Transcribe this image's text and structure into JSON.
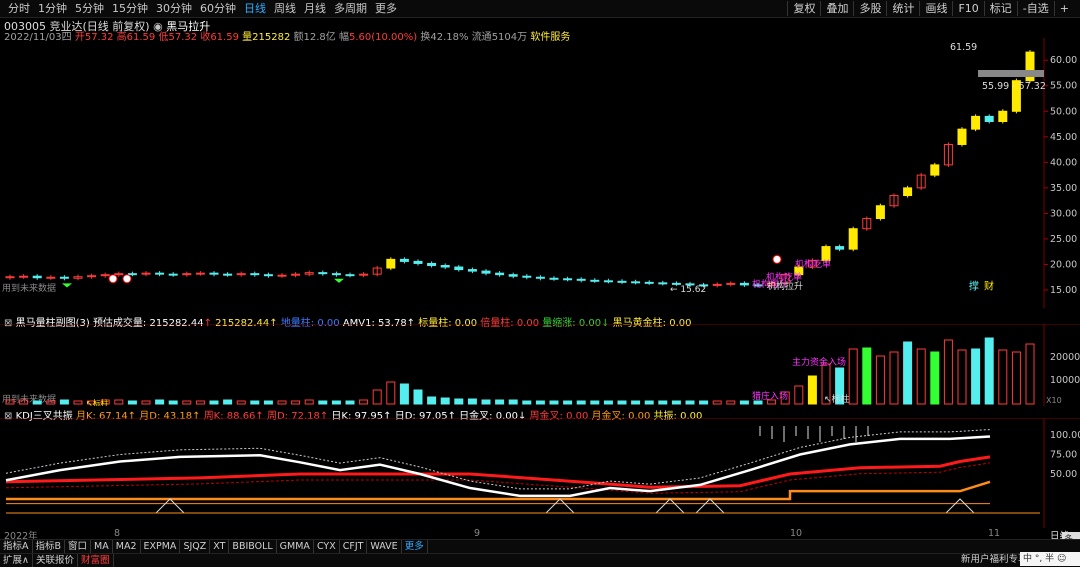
{
  "top_tabs": [
    "分时",
    "1分钟",
    "5分钟",
    "15分钟",
    "30分钟",
    "60分钟",
    "日线",
    "周线",
    "月线",
    "多周期",
    "更多"
  ],
  "active_tab": "日线",
  "right_tools": [
    "复权",
    "叠加",
    "多股",
    "统计",
    "画线",
    "F10",
    "标记",
    "-自选",
    "+"
  ],
  "title": {
    "code": "003005",
    "name": "竞业达(日线 前复权)",
    "indicator": "黑马拉升"
  },
  "quote": {
    "date": "2022/11/03四",
    "open_label": "开",
    "open": "57.32",
    "high_label": "高",
    "high": "61.59",
    "low_label": "低",
    "low": "57.32",
    "close_label": "收",
    "close": "61.59",
    "vol_label": "量",
    "vol": "215282",
    "amount_label": "额",
    "amount": "12.8亿",
    "chg_label": "幅",
    "chg": "5.60(10.00%)",
    "turnover_label": "换",
    "turnover": "42.18%",
    "float_label": "流通",
    "float": "5104万",
    "service": "软件服务"
  },
  "price_axis": [
    "60.00",
    "55.00",
    "50.00",
    "45.00",
    "40.00",
    "35.00",
    "30.00",
    "25.00",
    "20.00",
    "15.00"
  ],
  "annotations": {
    "max_label": "61.59",
    "range_label": "55.99 - 57.32",
    "low_label": "15.62",
    "future_text": "用到未来数据",
    "future_text2": "用到未来数据",
    "sig1": "机构吃单",
    "sig2": "机构吃单",
    "sig3": "机构拉升",
    "sig4": "机构拉升",
    "badge1": "撑",
    "badge2": "财",
    "sig5": "黑马",
    "sig6": "猎庄入场",
    "sig7": "猎庄",
    "sig8": "主力资金入场",
    "sig9": "标柱"
  },
  "panel2": {
    "name": "黑马量柱副图(3)",
    "est_label": "预估成交量:",
    "est_val": "215282.44",
    "est_arrow": "↑",
    "val2": "215282.44↑",
    "vol_ma_label": "地量柱: 0.00",
    "amv_label": "AMV1: 53.78↑",
    "biao_label": "标量柱: 0.00",
    "bei_label": "倍量柱: 0.00",
    "suo_label": "量缩涨: 0.00↓",
    "hj_label": "黑马黄金柱: 0.00",
    "axis": [
      "20000",
      "10000"
    ],
    "x10": "X10"
  },
  "panel3": {
    "name": "KDJ三叉共振",
    "items": [
      {
        "t": "月K: 67.14↑",
        "c": "orange"
      },
      {
        "t": "月D: 43.18↑",
        "c": "orange"
      },
      {
        "t": "周K: 88.66↑",
        "c": "red"
      },
      {
        "t": "周D: 72.18↑",
        "c": "red"
      },
      {
        "t": "日K: 97.95↑",
        "c": "white"
      },
      {
        "t": "日D: 97.05↑",
        "c": "white"
      },
      {
        "t": "日金叉: 0.00↓",
        "c": "white"
      },
      {
        "t": "周金叉: 0.00",
        "c": "red"
      },
      {
        "t": "月金叉: 0.00",
        "c": "orange"
      },
      {
        "t": "共振: 0.00",
        "c": "yellow"
      }
    ],
    "axis": [
      "100.00",
      "75.00",
      "50.00"
    ]
  },
  "date_axis": [
    "2022年",
    "8",
    "9",
    "10",
    "11"
  ],
  "corner_label": "日线",
  "bottom_tabs": [
    "指标A",
    "指标B",
    "窗口",
    "MA",
    "MA2",
    "EXPMA",
    "SJQZ",
    "XT",
    "BBIBOLL",
    "GMMA",
    "CYX",
    "CFJT",
    "WAVE",
    "更多"
  ],
  "status_tabs": [
    "扩展∧",
    "关联报价",
    "财富圈"
  ],
  "promo": "新用户福利专享 图",
  "side_buttons": [
    "多股"
  ],
  "ime": "中 °, 半 ☺",
  "chart_data": {
    "type": "candlestick",
    "closes": [
      17.6,
      17.7,
      17.4,
      17.5,
      17.3,
      17.6,
      17.8,
      18.0,
      18.2,
      18.1,
      18.3,
      18.1,
      18.0,
      18.2,
      18.3,
      18.1,
      18.0,
      18.2,
      18.0,
      17.8,
      17.9,
      18.1,
      18.4,
      18.2,
      18.0,
      17.9,
      18.1,
      19.3,
      21.0,
      20.6,
      20.2,
      19.8,
      19.5,
      19.0,
      18.7,
      18.3,
      18.0,
      17.7,
      17.5,
      17.3,
      17.2,
      17.1,
      16.9,
      16.8,
      16.7,
      16.6,
      16.5,
      16.4,
      16.3,
      16.2,
      16.0,
      15.9,
      16.1,
      16.3,
      16.0,
      15.9,
      16.4,
      18.0,
      19.5,
      20.8,
      23.5,
      23.0,
      27.0,
      29.0,
      31.5,
      33.5,
      35.0,
      37.5,
      39.5,
      43.5,
      46.5,
      49.0,
      48.0,
      50.0,
      55.99,
      61.59
    ],
    "ylim": [
      15,
      62
    ]
  }
}
